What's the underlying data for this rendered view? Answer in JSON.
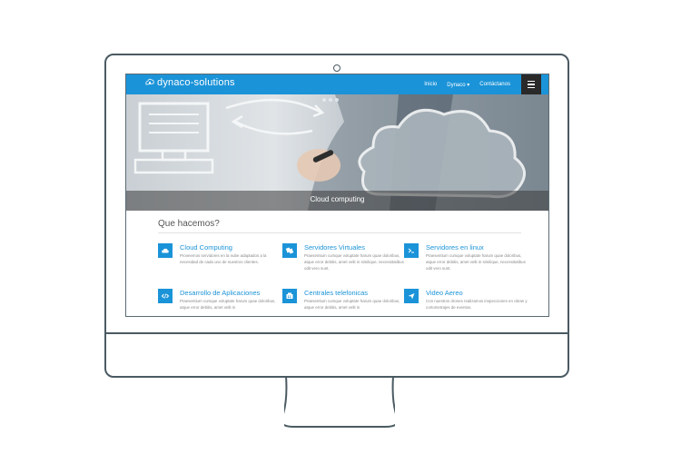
{
  "nav": {
    "brand": "dynaco-solutions",
    "menu": [
      "Inicio",
      "Dynaco ▾",
      "Contáctanos"
    ]
  },
  "hero": {
    "caption": "Cloud computing"
  },
  "section": {
    "title": "Que hacemos?"
  },
  "services": [
    {
      "title": "Cloud Computing",
      "icon": "cloud-icon",
      "desc": "Proveemos servidores en la nube adaptados a la necesidad de cada uno de nuestros clientes."
    },
    {
      "title": "Servidores Virtuales",
      "icon": "servers-icon",
      "desc": "Praesentium cumque voluptate harum quae doloribus, atque error debitis, amet velit in similique, necessitatibus odit vero sunt."
    },
    {
      "title": "Servidores en linux",
      "icon": "terminal-icon",
      "desc": "Praesentium cumque voluptate harum quae doloribus, atque error debitis, amet velit in similique, necessitatibus odit vero sunt."
    },
    {
      "title": "Desarrollo de Aplicaciones",
      "icon": "code-icon",
      "desc": "Praesentium cumque voluptate harum quae doloribus, atque error debitis, amet velit in"
    },
    {
      "title": "Centrales telefonicas",
      "icon": "phone-icon",
      "desc": "Praesentium cumque voluptate harum quae doloribus, atque error debitis, amet velit in"
    },
    {
      "title": "Video Aereo",
      "icon": "paper-plane-icon",
      "desc": "Con nuestros drones realizamos inspecciones en obras y cortometrajes de eventos."
    }
  ],
  "colors": {
    "accent": "#1b93d8",
    "menu_button": "#2a2a2a"
  }
}
